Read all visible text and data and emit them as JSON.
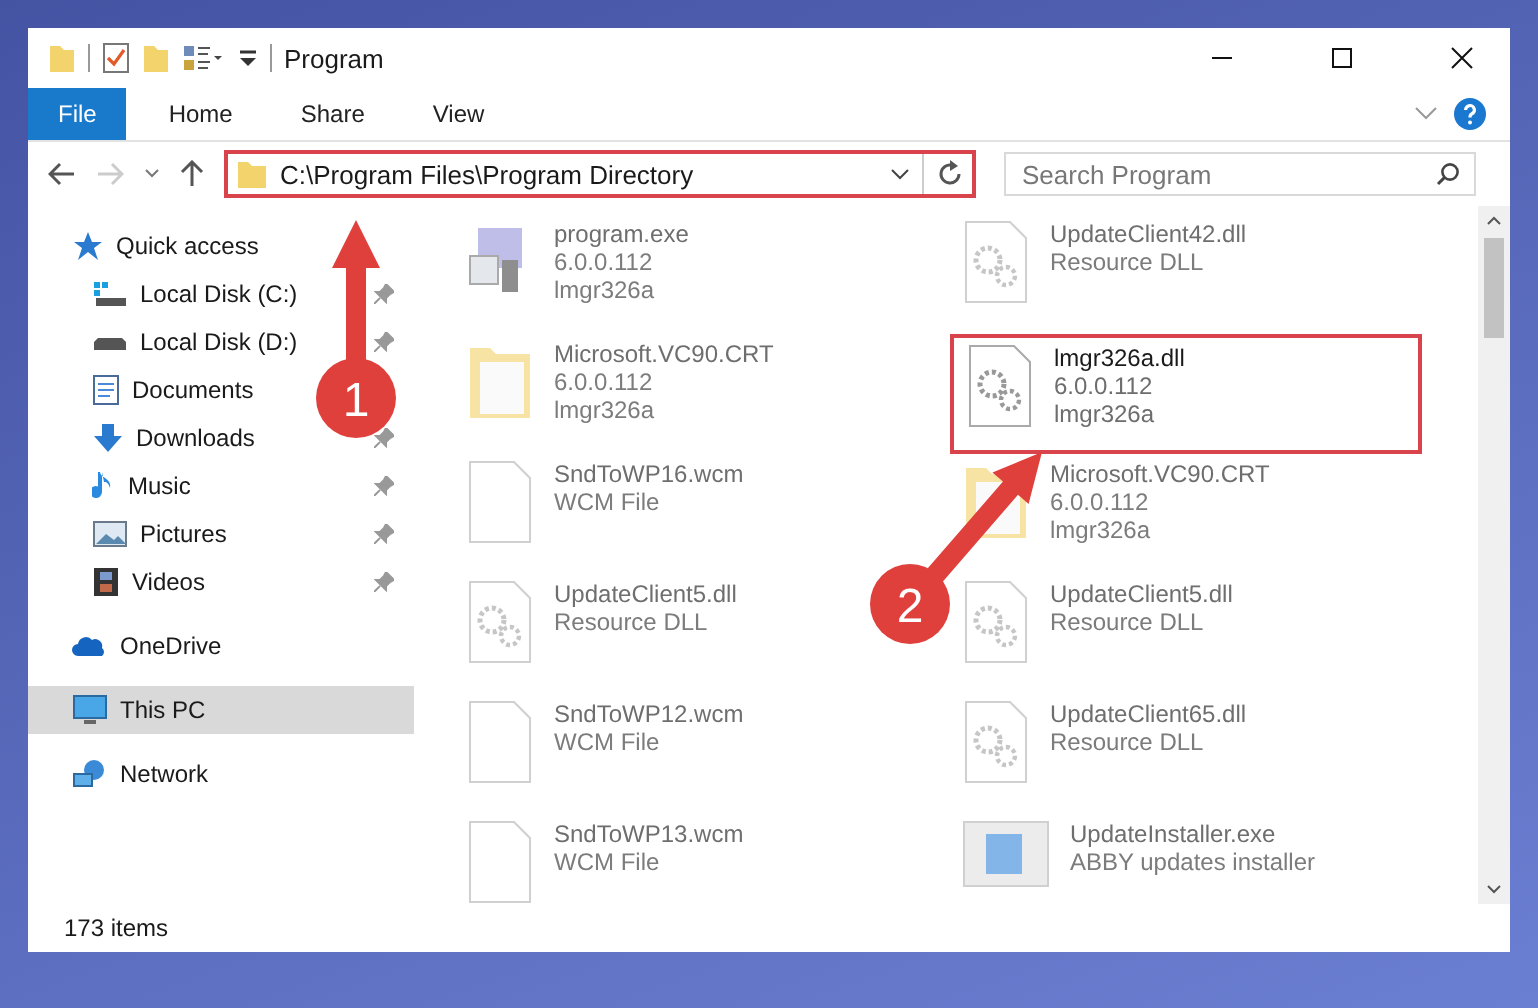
{
  "window": {
    "title": "Program"
  },
  "ribbon_tabs": [
    {
      "label": "File",
      "selected": true
    },
    {
      "label": "Home",
      "selected": false
    },
    {
      "label": "Share",
      "selected": false
    },
    {
      "label": "View",
      "selected": false
    }
  ],
  "address": {
    "path": "C:\\Program Files\\Program Directory",
    "highlighted": true
  },
  "search": {
    "placeholder": "Search Program"
  },
  "sidebar": {
    "items": [
      {
        "label": "Quick access",
        "kind": "star",
        "selected": false,
        "children": [
          {
            "label": "Local Disk (C:)",
            "kind": "disk-c",
            "pinned": true,
            "selected": false
          },
          {
            "label": "Local Disk (D:)",
            "kind": "disk",
            "pinned": true,
            "selected": false
          },
          {
            "label": "Documents",
            "kind": "documents",
            "selected": false
          },
          {
            "label": "Downloads",
            "kind": "downloads",
            "pinned": true,
            "selected": false
          },
          {
            "label": "Music",
            "kind": "music",
            "pinned": true,
            "selected": false
          },
          {
            "label": "Pictures",
            "kind": "pictures",
            "pinned": true,
            "selected": false
          },
          {
            "label": "Videos",
            "kind": "videos",
            "pinned": true,
            "selected": false
          }
        ]
      },
      {
        "label": "OneDrive",
        "kind": "cloud",
        "selected": false
      },
      {
        "label": "This PC",
        "kind": "pc",
        "selected": true
      },
      {
        "label": "Network",
        "kind": "network",
        "selected": false
      }
    ]
  },
  "files": [
    {
      "name": "program.exe",
      "details": [
        "6.0.0.112",
        "lmgr326a"
      ],
      "kind": "exe",
      "blurred": true,
      "highlighted": false
    },
    {
      "name": "UpdateClient42.dll",
      "details": [
        "Resource DLL"
      ],
      "kind": "dll",
      "blurred": true,
      "highlighted": false
    },
    {
      "name": "Microsoft.VC90.CRT",
      "details": [
        "6.0.0.112",
        "lmgr326a"
      ],
      "kind": "folder",
      "blurred": true,
      "highlighted": false
    },
    {
      "name": "lmgr326a.dll",
      "details": [
        "6.0.0.112",
        "lmgr326a"
      ],
      "kind": "dll",
      "blurred": false,
      "highlighted": true
    },
    {
      "name": "SndToWP16.wcm",
      "details": [
        "WCM File"
      ],
      "kind": "file",
      "blurred": true,
      "highlighted": false
    },
    {
      "name": "Microsoft.VC90.CRT",
      "details": [
        "6.0.0.112",
        "lmgr326a"
      ],
      "kind": "folder",
      "blurred": true,
      "highlighted": false
    },
    {
      "name": "UpdateClient5.dll",
      "details": [
        "Resource DLL"
      ],
      "kind": "dll",
      "blurred": true,
      "highlighted": false
    },
    {
      "name": "UpdateClient5.dll",
      "details": [
        "Resource DLL"
      ],
      "kind": "dll",
      "blurred": true,
      "highlighted": false
    },
    {
      "name": "SndToWP12.wcm",
      "details": [
        "WCM File"
      ],
      "kind": "file",
      "blurred": true,
      "highlighted": false
    },
    {
      "name": "UpdateClient65.dll",
      "details": [
        "Resource DLL"
      ],
      "kind": "dll",
      "blurred": true,
      "highlighted": false
    },
    {
      "name": "SndToWP13.wcm",
      "details": [
        "WCM File"
      ],
      "kind": "file",
      "blurred": true,
      "highlighted": false
    },
    {
      "name": "UpdateInstaller.exe",
      "details": [
        "ABBY updates installer"
      ],
      "kind": "installer",
      "blurred": true,
      "highlighted": false
    }
  ],
  "annotations": [
    {
      "number": "1"
    },
    {
      "number": "2"
    }
  ],
  "status_bar": {
    "count": "173 items"
  }
}
